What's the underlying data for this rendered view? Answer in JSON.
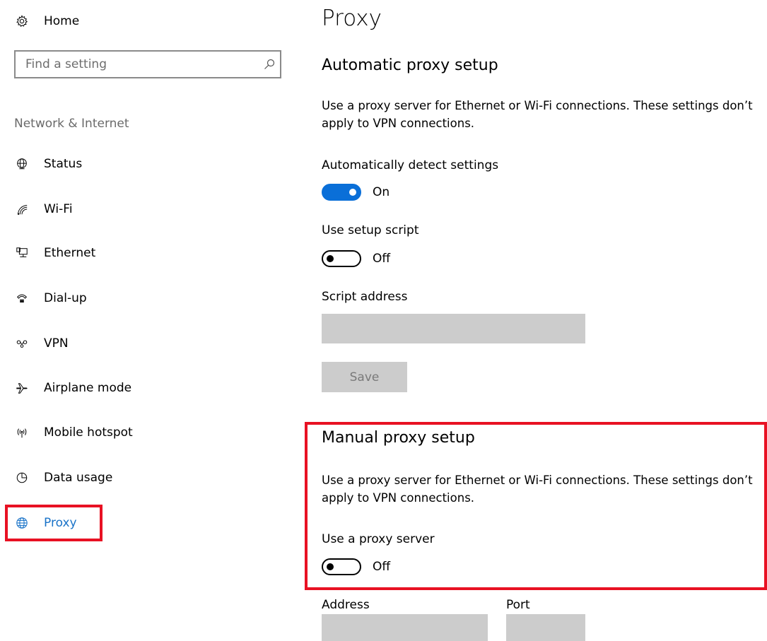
{
  "sidebar": {
    "home_label": "Home",
    "search_placeholder": "Find a setting",
    "section_title": "Network & Internet",
    "items": [
      {
        "label": "Status",
        "icon": "globe-status-icon"
      },
      {
        "label": "Wi-Fi",
        "icon": "wifi-icon"
      },
      {
        "label": "Ethernet",
        "icon": "ethernet-icon"
      },
      {
        "label": "Dial-up",
        "icon": "dialup-icon"
      },
      {
        "label": "VPN",
        "icon": "vpn-icon"
      },
      {
        "label": "Airplane mode",
        "icon": "airplane-icon"
      },
      {
        "label": "Mobile hotspot",
        "icon": "hotspot-icon"
      },
      {
        "label": "Data usage",
        "icon": "data-usage-icon"
      },
      {
        "label": "Proxy",
        "icon": "globe-icon",
        "selected": true
      }
    ]
  },
  "main": {
    "title": "Proxy",
    "automatic": {
      "heading": "Automatic proxy setup",
      "description": "Use a proxy server for Ethernet or Wi-Fi connections. These settings don’t apply to VPN connections.",
      "detect_label": "Automatically detect settings",
      "detect_state": "On",
      "script_label": "Use setup script",
      "script_state": "Off",
      "script_address_label": "Script address",
      "script_address_value": "",
      "save_label": "Save"
    },
    "manual": {
      "heading": "Manual proxy setup",
      "description": "Use a proxy server for Ethernet or Wi-Fi connections. These settings don’t apply to VPN connections.",
      "use_proxy_label": "Use a proxy server",
      "use_proxy_state": "Off",
      "address_label": "Address",
      "address_value": "",
      "port_label": "Port",
      "port_value": ""
    }
  },
  "colors": {
    "accent": "#0a6fd8",
    "highlight_box": "#e81123",
    "disabled_field": "#cccccc"
  }
}
